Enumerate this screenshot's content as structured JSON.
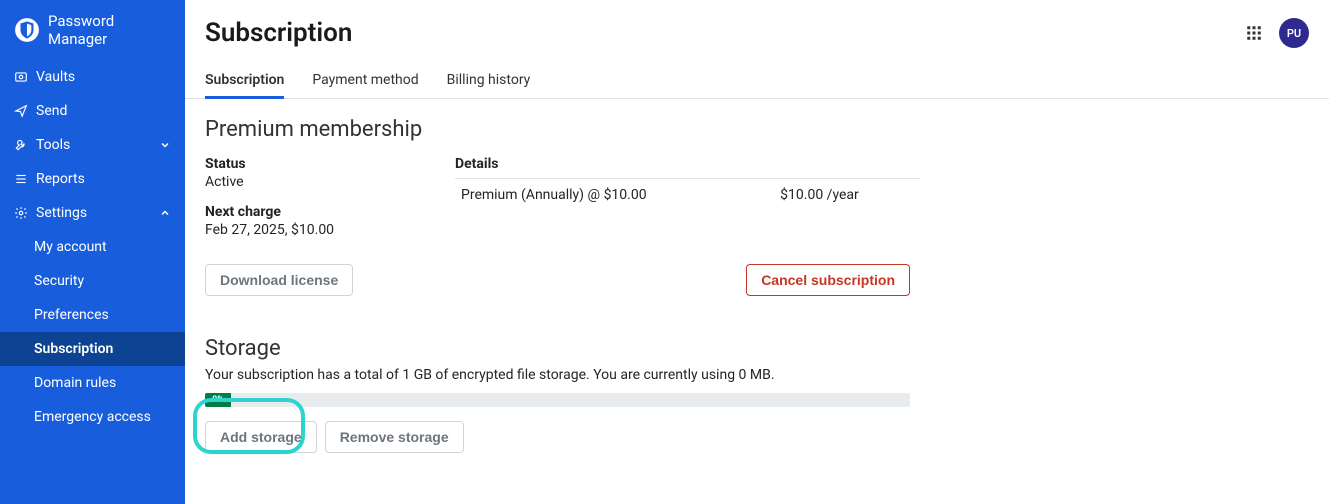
{
  "brand": "Password Manager",
  "sidebar": {
    "items": [
      {
        "label": "Vaults"
      },
      {
        "label": "Send"
      },
      {
        "label": "Tools"
      },
      {
        "label": "Reports"
      },
      {
        "label": "Settings"
      }
    ],
    "settings_sub": [
      {
        "label": "My account"
      },
      {
        "label": "Security"
      },
      {
        "label": "Preferences"
      },
      {
        "label": "Subscription"
      },
      {
        "label": "Domain rules"
      },
      {
        "label": "Emergency access"
      }
    ]
  },
  "header": {
    "title": "Subscription",
    "avatar": "PU"
  },
  "tabs": [
    {
      "label": "Subscription"
    },
    {
      "label": "Payment method"
    },
    {
      "label": "Billing history"
    }
  ],
  "premium": {
    "heading": "Premium membership",
    "status_label": "Status",
    "status_value": "Active",
    "next_label": "Next charge",
    "next_value": "Feb 27, 2025, $10.00",
    "details_label": "Details",
    "details_line": "Premium (Annually) @ $10.00",
    "details_price": "$10.00 /year",
    "download_btn": "Download license",
    "cancel_btn": "Cancel subscription"
  },
  "storage": {
    "heading": "Storage",
    "desc": "Your subscription has a total of 1 GB of encrypted file storage. You are currently using 0 MB.",
    "percent": "0%",
    "add_btn": "Add storage",
    "remove_btn": "Remove storage"
  }
}
